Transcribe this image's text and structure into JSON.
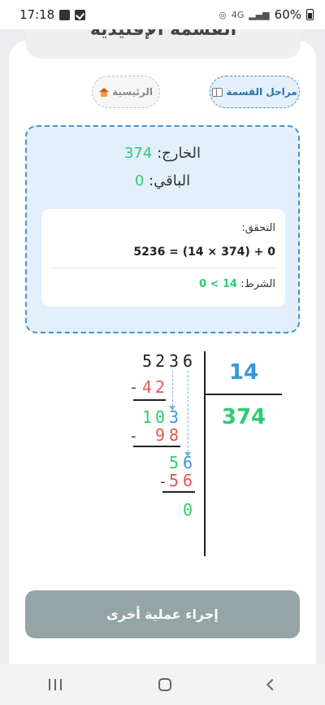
{
  "status_bar": {
    "time": "17:18",
    "network": "4G",
    "battery": "60%"
  },
  "header": {
    "title": "القسمة الإقليدية"
  },
  "nav_buttons": {
    "steps_label": "مراحل القسمة",
    "home_label": "الرئيسية"
  },
  "result": {
    "quotient_label": "الخارج:",
    "quotient_value": "374",
    "remainder_label": "الباقي:",
    "remainder_value": "0",
    "verify_label": "التحقق:",
    "verify_equation": "5236 = (14 × 374) + 0",
    "condition_label": "الشرط:",
    "condition_value": "0 < 14"
  },
  "long_division": {
    "dividend": [
      "5",
      "2",
      "3",
      "6"
    ],
    "divisor": "14",
    "quotient": "374",
    "step1_subtract": [
      "4",
      "2"
    ],
    "step1_result": [
      "1",
      "0",
      "3"
    ],
    "step2_subtract": [
      "9",
      "8"
    ],
    "step2_result": [
      "5",
      "6"
    ],
    "step3_subtract": [
      "5",
      "6"
    ],
    "final_remainder": "0",
    "minus_sign": "-"
  },
  "actions": {
    "new_operation_label": "إجراء عملية أخرى"
  },
  "colors": {
    "green": "#2ecc71",
    "red": "#e0574f",
    "blue": "#3498db",
    "button_gray": "#95a5a6"
  }
}
